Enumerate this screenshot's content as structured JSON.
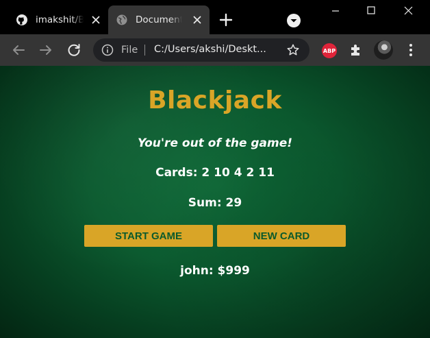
{
  "browser": {
    "tabs": [
      {
        "title": "imakshit/Blackjack",
        "favicon": "github-icon",
        "active": false
      },
      {
        "title": "Document",
        "favicon": "globe-icon",
        "active": true
      }
    ],
    "address_bar": {
      "scheme_label": "File",
      "url": "C:/Users/akshi/Deskt..."
    },
    "extensions": {
      "adblock_label": "ABP"
    }
  },
  "page": {
    "title": "Blackjack",
    "message": "You're out of the game!",
    "cards_label": "Cards:",
    "cards": [
      2,
      10,
      4,
      2,
      11
    ],
    "cards_text": "Cards: 2 10 4 2 11",
    "sum_label": "Sum:",
    "sum": 29,
    "sum_text": "Sum: 29",
    "buttons": {
      "start": "START GAME",
      "new_card": "NEW CARD"
    },
    "player": {
      "name": "john",
      "chips": 999,
      "text": "john: $999"
    }
  },
  "colors": {
    "accent_gold": "#d9a527",
    "felt_green": "#0b5a2f",
    "button_text": "#0b5a2c"
  }
}
